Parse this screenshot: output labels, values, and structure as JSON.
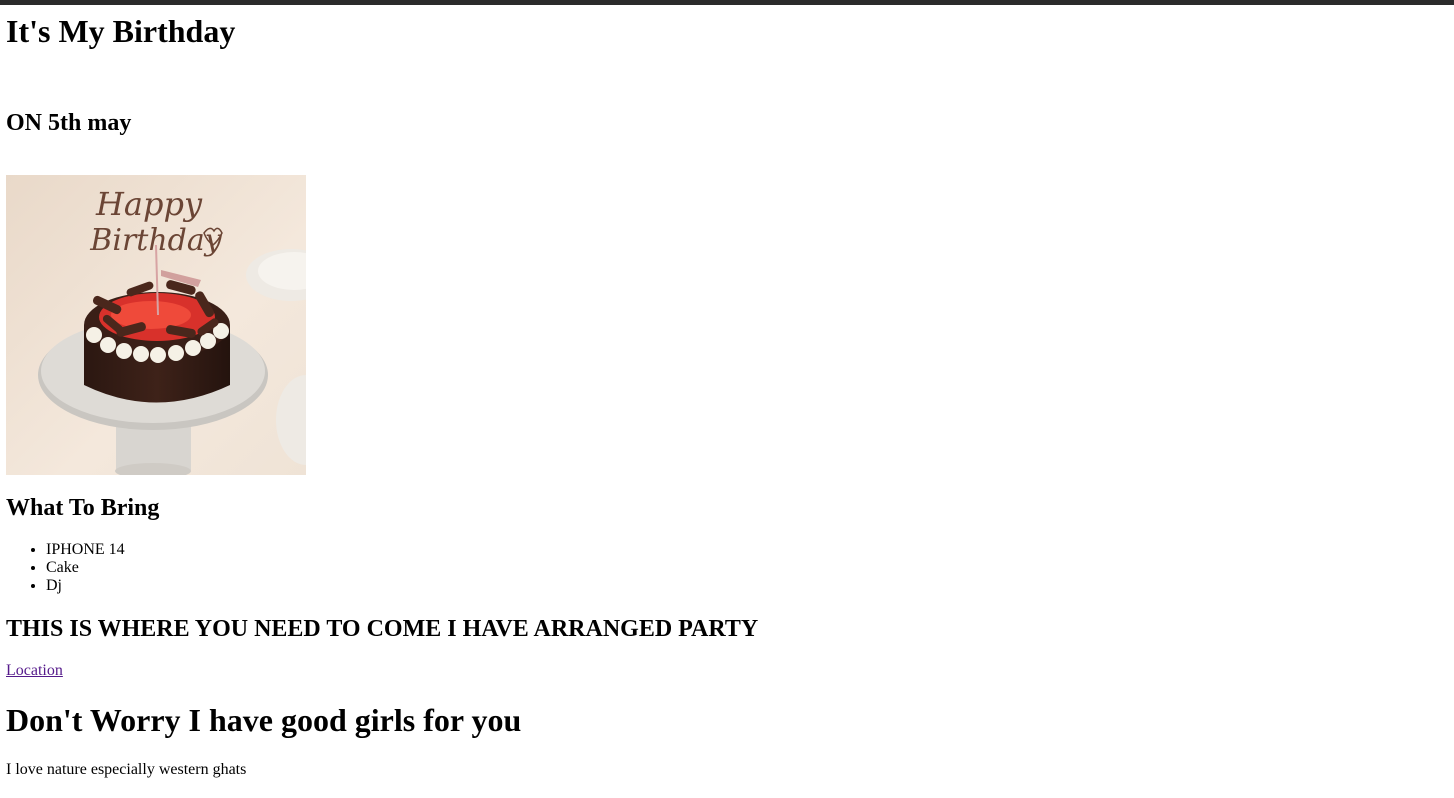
{
  "page": {
    "title": "It's My Birthday",
    "date": "ON 5th may",
    "image": {
      "topper_text_1": "Happy",
      "topper_text_2": "Birthday",
      "alt": "Happy Birthday cake"
    },
    "bring": {
      "heading": "What To Bring",
      "items": [
        "IPHONE 14",
        "Cake",
        "Dj"
      ]
    },
    "where": {
      "heading": "THIS IS WHERE YOU NEED TO COME I HAVE ARRANGED PARTY",
      "link_label": "Location"
    },
    "girls_heading": "Don't Worry I have good girls for you",
    "nature_text": "I love nature especially western ghats"
  },
  "colors": {
    "topbar": "#2b2b2b",
    "visited_link": "#551a8b"
  }
}
